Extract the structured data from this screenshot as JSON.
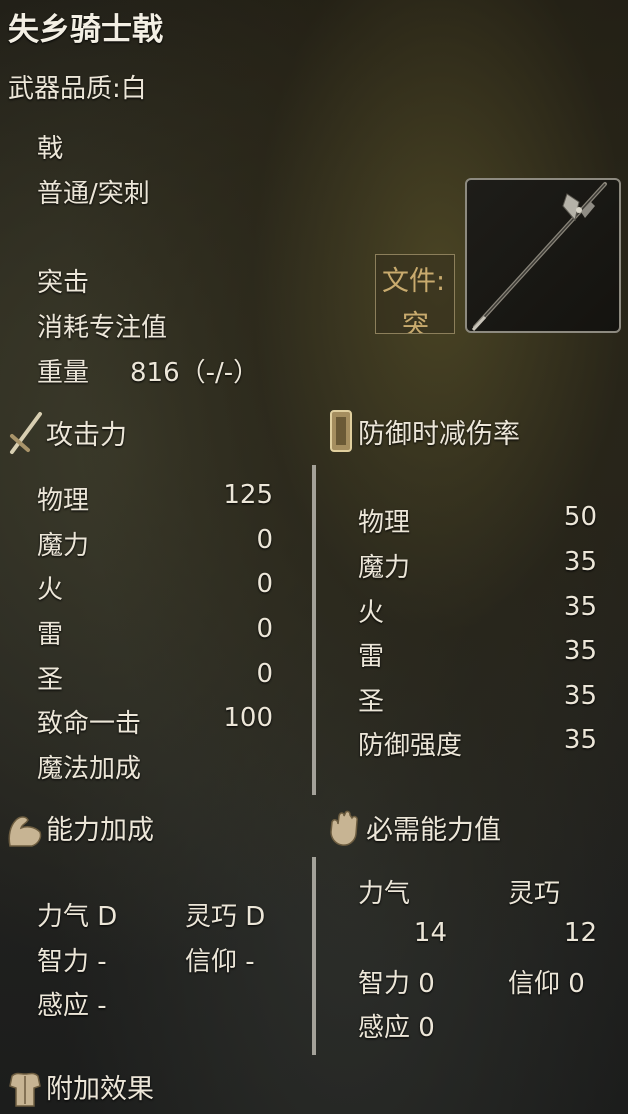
{
  "item": {
    "name": "失乡骑士戟",
    "quality_label": "武器品质:白",
    "weapon_type": "戟",
    "damage_type": "普通/突刺",
    "skill": "突击",
    "fp_cost": "消耗专注值",
    "weight_label": "重量",
    "weight_value": "816（-/-）",
    "file_label_1": "文件:",
    "file_label_2": "突"
  },
  "attack": {
    "header": "攻击力",
    "rows": [
      {
        "label": "物理",
        "value": "125"
      },
      {
        "label": "魔力",
        "value": "0"
      },
      {
        "label": "火",
        "value": "0"
      },
      {
        "label": "雷",
        "value": "0"
      },
      {
        "label": "圣",
        "value": "0"
      },
      {
        "label": "致命一击",
        "value": "100"
      },
      {
        "label": "魔法加成",
        "value": ""
      }
    ]
  },
  "guard": {
    "header": "防御时减伤率",
    "rows": [
      {
        "label": "物理",
        "value": "50"
      },
      {
        "label": "魔力",
        "value": "35"
      },
      {
        "label": "火",
        "value": "35"
      },
      {
        "label": "雷",
        "value": "35"
      },
      {
        "label": "圣",
        "value": "35"
      },
      {
        "label": "防御强度",
        "value": "35"
      }
    ]
  },
  "scaling": {
    "header": "能力加成",
    "str": "力气 D",
    "dex": "灵巧 D",
    "int": "智力  -",
    "fai": "信仰  -",
    "arc": "感应  -"
  },
  "requirements": {
    "header": "必需能力值",
    "str_label": "力气",
    "str_value": "14",
    "dex_label": "灵巧",
    "dex_value": "12",
    "int": "智力  0",
    "fai": "信仰  0",
    "arc": "感应  0"
  },
  "effects": {
    "header": "附加效果"
  },
  "colors": {
    "text": "#ece6d8",
    "accent_gold": "#c9ab6e",
    "divider": "#b9b6ae"
  },
  "icons": {
    "attack": "sword-icon",
    "guard": "shield-icon",
    "scaling": "flexed-arm-icon",
    "requirements": "open-hand-icon",
    "effects": "armor-icon",
    "weapon": "halberd-image"
  }
}
